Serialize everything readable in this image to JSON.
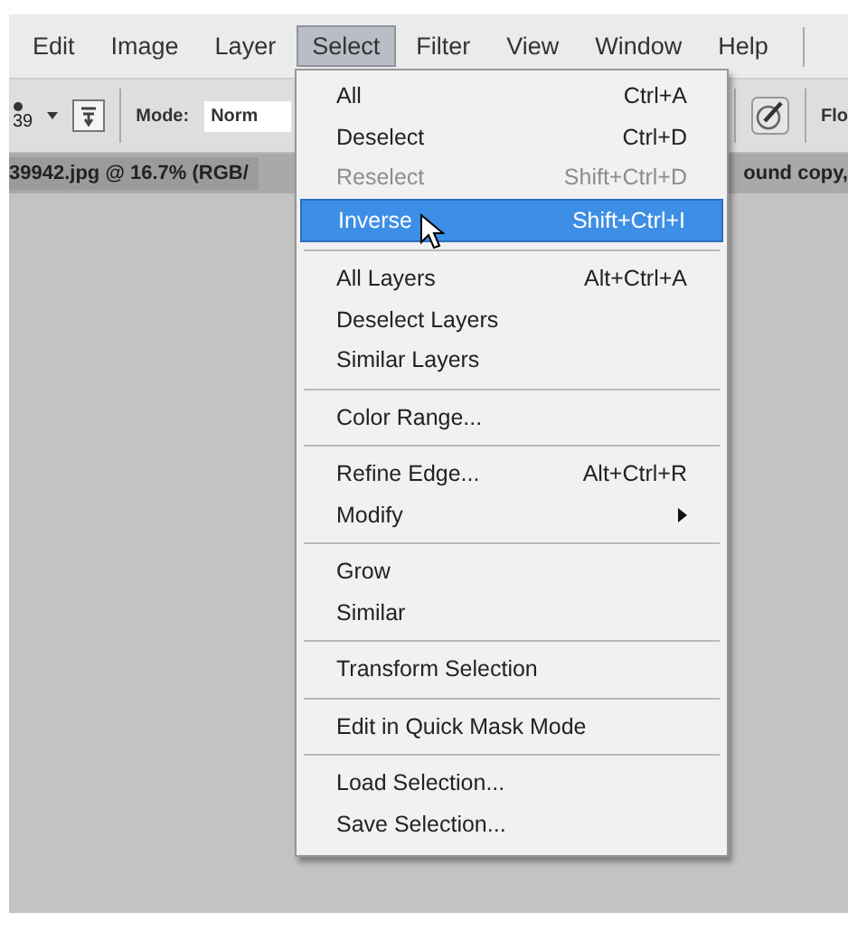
{
  "menu_bar": [
    {
      "label": "Edit",
      "selected": false
    },
    {
      "label": "Image",
      "selected": false
    },
    {
      "label": "Layer",
      "selected": false
    },
    {
      "label": "Select",
      "selected": true
    },
    {
      "label": "Filter",
      "selected": false
    },
    {
      "label": "View",
      "selected": false
    },
    {
      "label": "Window",
      "selected": false
    },
    {
      "label": "Help",
      "selected": false
    }
  ],
  "options_bar": {
    "brush_size": "39",
    "mode_label": "Mode:",
    "mode_value": "Norm",
    "right_label": "Flo"
  },
  "document_tab": {
    "title": "39942.jpg @ 16.7% (RGB/",
    "right_text": "ound copy,"
  },
  "menu_groups": [
    [
      {
        "label": "All",
        "shortcut": "Ctrl+A",
        "disabled": false,
        "selected": false
      },
      {
        "label": "Deselect",
        "shortcut": "Ctrl+D",
        "disabled": false,
        "selected": false
      },
      {
        "label": "Reselect",
        "shortcut": "Shift+Ctrl+D",
        "disabled": true,
        "selected": false
      },
      {
        "label": "Inverse",
        "shortcut": "Shift+Ctrl+I",
        "disabled": false,
        "selected": true
      }
    ],
    [
      {
        "label": "All Layers",
        "shortcut": "Alt+Ctrl+A",
        "disabled": false,
        "selected": false
      },
      {
        "label": "Deselect Layers",
        "disabled": false,
        "selected": false
      },
      {
        "label": "Similar Layers",
        "disabled": false,
        "selected": false
      }
    ],
    [
      {
        "label": "Color Range...",
        "disabled": false,
        "selected": false
      }
    ],
    [
      {
        "label": "Refine Edge...",
        "shortcut": "Alt+Ctrl+R",
        "disabled": false,
        "selected": false
      },
      {
        "label": "Modify",
        "disabled": false,
        "selected": false,
        "submenu": true
      }
    ],
    [
      {
        "label": "Grow",
        "disabled": false,
        "selected": false
      },
      {
        "label": "Similar",
        "disabled": false,
        "selected": false
      }
    ],
    [
      {
        "label": "Transform Selection",
        "disabled": false,
        "selected": false
      }
    ],
    [
      {
        "label": "Edit in Quick Mask Mode",
        "disabled": false,
        "selected": false
      }
    ],
    [
      {
        "label": "Load Selection...",
        "disabled": false,
        "selected": false
      },
      {
        "label": "Save Selection...",
        "disabled": false,
        "selected": false
      }
    ]
  ]
}
